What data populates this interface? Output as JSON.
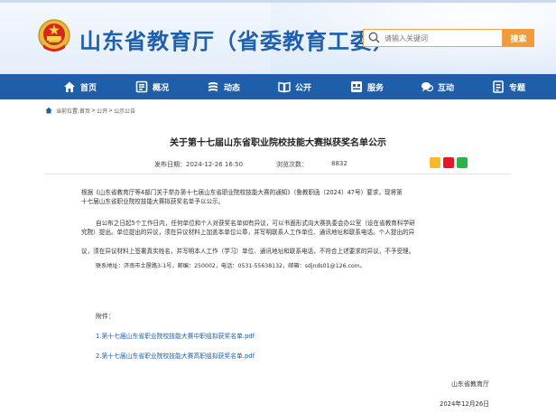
{
  "site": {
    "title": "山东省教育厅（省委教育工委）"
  },
  "search": {
    "placeholder": "请输入关键词",
    "button": "搜索"
  },
  "nav": {
    "items": [
      {
        "label": "首页",
        "icon": "home-icon"
      },
      {
        "label": "概况",
        "icon": "overview-icon"
      },
      {
        "label": "动态",
        "icon": "news-icon"
      },
      {
        "label": "公开",
        "icon": "book-icon"
      },
      {
        "label": "服务",
        "icon": "service-icon"
      },
      {
        "label": "互动",
        "icon": "chat-icon"
      },
      {
        "label": "专题",
        "icon": "topic-icon"
      }
    ]
  },
  "breadcrumb": {
    "prefix": "当前位置:",
    "items": [
      "首页",
      "公开",
      "公示公告"
    ],
    "sep": ">"
  },
  "article": {
    "title": "关于第十七届山东省职业院校技能大赛拟获奖名单公示",
    "publish_label": "发布日期：",
    "publish_date": "2024-12-26 16:50",
    "views_label": "浏览次数：",
    "views": "8832",
    "p1_line1": "根据《山东省教育厅等4部门关于举办第十七届山东省职业院校技能大赛的通知》（鲁教职函〔2024〕47号）要求，现将第",
    "p1_line2": "十七届山东省职业院校技能大赛拟获奖名单予以公示。",
    "p2_line1": "自公布之日起5个工作日内，任何单位和个人对获奖名单如有异议，可以书面形式向大赛执委会办公室（设在省教育科学研",
    "p2_line2": "究院）提出。单位提出的异议，须在异议材料上加盖本单位公章，并写明联系人工作单位、通讯地址和联系电话。个人提出的异",
    "p2_line3": "议，须在异议材料上签署真实姓名，并写明本人工作（学习）单位、通讯地址和联系电话，不符合上述要求的异议，不予受理。",
    "p3": "联系地址：济南市土屋路3-1号，邮编：250002，电话：0531-55638132，邮箱：sdjnds01@126.com。",
    "attach_label": "附件：",
    "attachments": [
      "1.第十七届山东省职业院校技能大赛中职组拟获奖名单.pdf",
      "2.第十七届山东省职业院校技能大赛高职组拟获奖名单.pdf"
    ],
    "signature": "山东省教育厅",
    "sign_date": "2024年12月26日"
  },
  "colors": {
    "brand_blue": "#1f5ea8",
    "accent_orange": "#f39a3a",
    "emblem_red": "#d6271c"
  },
  "share_icons": [
    "qzone-icon",
    "weibo-icon",
    "wechat-icon"
  ]
}
